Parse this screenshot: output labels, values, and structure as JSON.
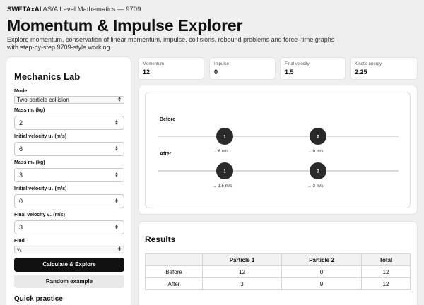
{
  "header": {
    "brand": "SWETAxAI",
    "course": "AS/A Level Mathematics — 9709",
    "title": "Momentum & Impulse Explorer",
    "subtitle": "Explore momentum, conservation of linear momentum, impulse, collisions, rebound problems and force–time graphs with step-by-step 9709-style working."
  },
  "lab": {
    "title": "Mechanics Lab",
    "mode_label": "Mode",
    "mode_value": "Two-particle collision",
    "fields": [
      {
        "label": "Mass m₁ (kg)",
        "value": "2"
      },
      {
        "label": "Initial velocity u₁ (m/s)",
        "value": "6"
      },
      {
        "label": "Mass m₂ (kg)",
        "value": "3"
      },
      {
        "label": "Initial velocity u₂ (m/s)",
        "value": "0"
      },
      {
        "label": "Final velocity v₂ (m/s)",
        "value": "3"
      }
    ],
    "find_label": "Find",
    "find_value": "v₁",
    "calculate_label": "Calculate & Explore",
    "random_label": "Random example",
    "quick_practice": "Quick practice"
  },
  "stats": [
    {
      "label": "Momentum",
      "value": "12"
    },
    {
      "label": "Impulse",
      "value": "0"
    },
    {
      "label": "Final velocity",
      "value": "1.5"
    },
    {
      "label": "Kinetic energy",
      "value": "2.25"
    }
  ],
  "sim": {
    "before_label": "Before",
    "after_label": "After",
    "p1_label": "1",
    "p2_label": "2",
    "before_v1": "→ 6 m/s",
    "before_v2": "→ 0 m/s",
    "after_v1": "→ 1.5 m/s",
    "after_v2": "→ 3 m/s"
  },
  "results": {
    "title": "Results",
    "headers": [
      "",
      "Particle 1",
      "Particle 2",
      "Total"
    ],
    "rows": [
      [
        "Before",
        "12",
        "0",
        "12"
      ],
      [
        "After",
        "3",
        "9",
        "12"
      ]
    ]
  },
  "colors": {
    "primary": "#111111",
    "background": "#efefef",
    "card": "#ffffff"
  }
}
